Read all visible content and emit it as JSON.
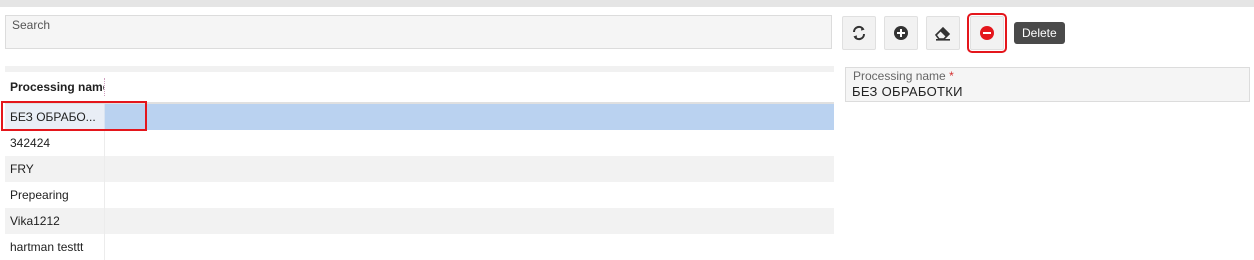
{
  "search": {
    "label": "Search"
  },
  "toolbar": {
    "refresh_icon": "refresh-icon",
    "add_icon": "plus-circle-icon",
    "clear_icon": "eraser-icon",
    "delete_icon": "minus-circle-icon",
    "delete_color": "#e4161c",
    "tooltip": "Delete"
  },
  "table": {
    "columns": [
      "Processing name"
    ],
    "rows": [
      {
        "name": "БЕЗ ОБРАБОТКИ",
        "display": "БЕЗ ОБРАБО...",
        "selected": true
      },
      {
        "name": "342424"
      },
      {
        "name": "FRY"
      },
      {
        "name": "Prepearing"
      },
      {
        "name": "Vika1212"
      },
      {
        "name": "hartman testtt"
      }
    ]
  },
  "detail": {
    "field_label": "Processing name",
    "required_mark": "*",
    "field_value": "БЕЗ ОБРАБОТКИ"
  },
  "colors": {
    "selected_row": "#bad2f0",
    "highlight": "#e4161c"
  }
}
